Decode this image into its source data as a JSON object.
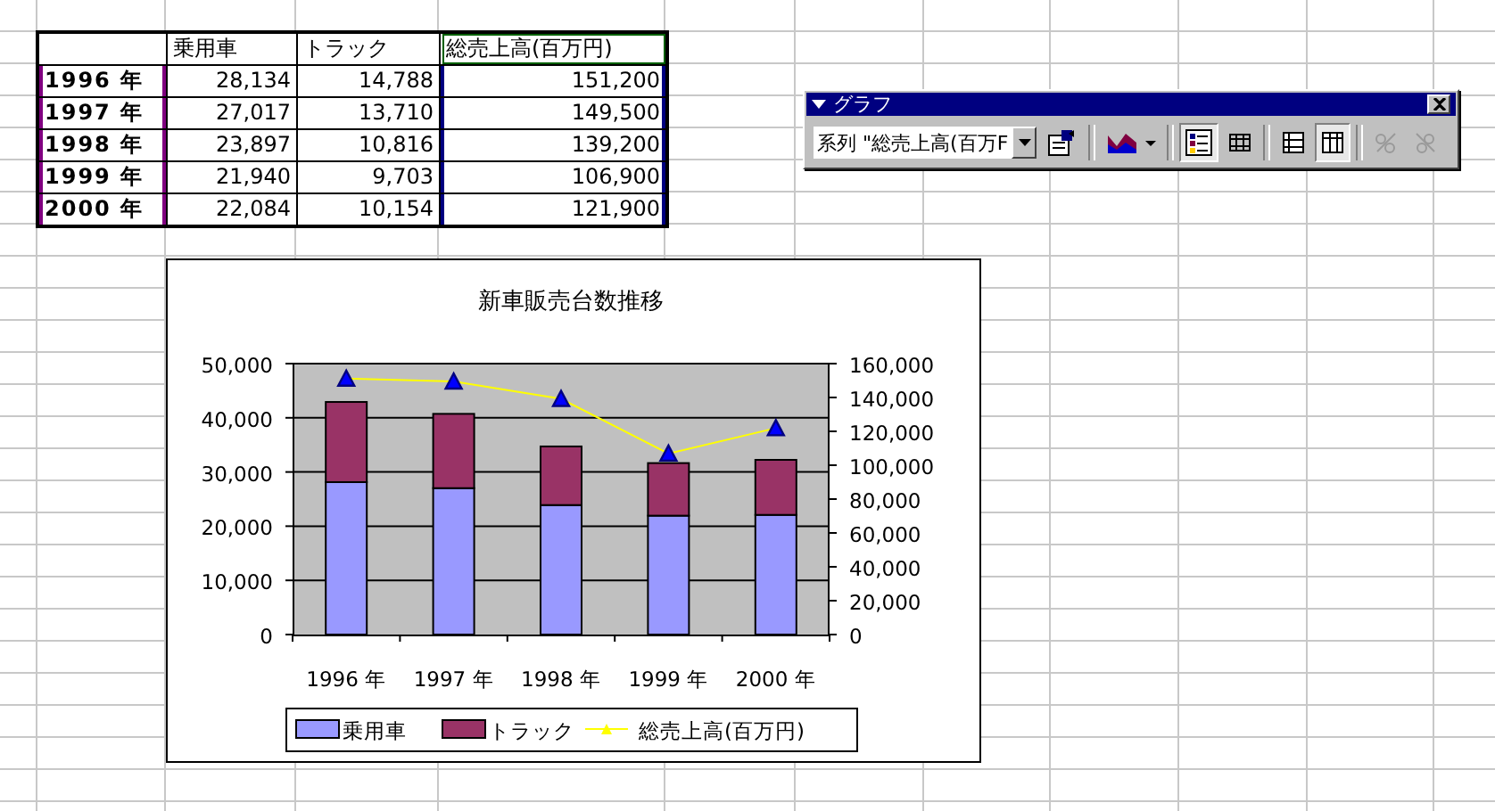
{
  "table": {
    "columns": [
      "乗用車",
      "トラック",
      "総売上高(百万円)"
    ],
    "rows": [
      {
        "label": "1996 年",
        "cells": [
          "28,134",
          "14,788",
          "151,200"
        ]
      },
      {
        "label": "1997 年",
        "cells": [
          "27,017",
          "13,710",
          "149,500"
        ]
      },
      {
        "label": "1998 年",
        "cells": [
          "23,897",
          "10,816",
          "139,200"
        ]
      },
      {
        "label": "1999 年",
        "cells": [
          "21,940",
          "9,703",
          "106,900"
        ]
      },
      {
        "label": "2000 年",
        "cells": [
          "22,084",
          "10,154",
          "121,900"
        ]
      }
    ]
  },
  "toolbar": {
    "title": "グラフ",
    "chart_object": "系列 \"総売上高(百万F",
    "buttons": [
      {
        "kind": "format",
        "selected": false,
        "disabled": false
      },
      {
        "kind": "chart-type",
        "selected": false,
        "disabled": false
      },
      {
        "kind": "legend",
        "selected": true,
        "disabled": false
      },
      {
        "kind": "data-table",
        "selected": false,
        "disabled": false
      },
      {
        "kind": "by-row",
        "selected": false,
        "disabled": false
      },
      {
        "kind": "by-column",
        "selected": true,
        "disabled": false
      },
      {
        "kind": "angle-down",
        "selected": false,
        "disabled": true
      },
      {
        "kind": "angle-up",
        "selected": false,
        "disabled": true
      }
    ]
  },
  "chart": {
    "chart_data": {
      "type": "bar",
      "title": "新車販売台数推移",
      "stacked": true,
      "grid": "y",
      "legend": "bottom",
      "categories": [
        "1996 年",
        "1997 年",
        "1998 年",
        "1999 年",
        "2000 年"
      ],
      "ylim": [
        0,
        50000
      ],
      "yticks": [
        {
          "value": 0,
          "label": "0"
        },
        {
          "value": 10000,
          "label": "10,000"
        },
        {
          "value": 20000,
          "label": "20,000"
        },
        {
          "value": 30000,
          "label": "30,000"
        },
        {
          "value": 40000,
          "label": "40,000"
        },
        {
          "value": 50000,
          "label": "50,000"
        }
      ],
      "y2lim": [
        0,
        160000
      ],
      "y2ticks": [
        {
          "value": 0,
          "label": "0"
        },
        {
          "value": 20000,
          "label": "20,000"
        },
        {
          "value": 40000,
          "label": "40,000"
        },
        {
          "value": 60000,
          "label": "60,000"
        },
        {
          "value": 80000,
          "label": "80,000"
        },
        {
          "value": 100000,
          "label": "100,000"
        },
        {
          "value": 120000,
          "label": "120,000"
        },
        {
          "value": 140000,
          "label": "140,000"
        },
        {
          "value": 160000,
          "label": "160,000"
        }
      ],
      "series": [
        {
          "name": "乗用車",
          "color": "#9999ff",
          "type": "bar",
          "values": [
            28134,
            27017,
            23897,
            21940,
            22084
          ]
        },
        {
          "name": "トラック",
          "color": "#993366",
          "type": "bar",
          "values": [
            14788,
            13710,
            10816,
            9703,
            10154
          ]
        },
        {
          "name": "総売上高(百万円)",
          "color": "#ffff00",
          "type": "line",
          "axis": "y2",
          "marker": "triangle",
          "values": [
            151200,
            149500,
            139200,
            106900,
            121900
          ]
        }
      ]
    }
  }
}
